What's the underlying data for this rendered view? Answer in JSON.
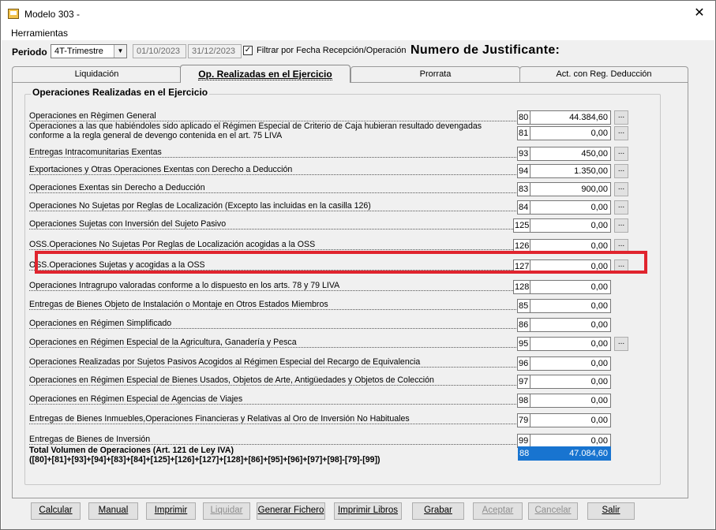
{
  "window": {
    "title": "Modelo 303 -",
    "close_glyph": "✕"
  },
  "menu": {
    "herramientas": "Herramientas"
  },
  "toolbar": {
    "periodo_label": "Periodo",
    "periodo_value": "4T-Trimestre",
    "date_from": "01/10/2023",
    "date_to": "31/12/2023",
    "filter_label": "Filtrar por Fecha Recepción/Operación",
    "filter_checked": "✓",
    "justificante": "Numero de Justificante:"
  },
  "tabs": [
    "Liquidación",
    "Op. Realizadas en el Ejercicio",
    "Prorrata",
    "Act. con Reg. Deducción"
  ],
  "group_title": "Operaciones Realizadas en el Ejercicio",
  "rows": [
    {
      "label": "Operaciones en Règimen General",
      "box": "80",
      "value": "44.384,60",
      "btn": "..."
    },
    {
      "label": "Operaciones a las que habiéndoles sido aplicado el Régimen Especial de Criterio de Caja hubieran resultado devengadas conforme a la regla general de devengo contenida en el art. 75 LIVA",
      "box": "81",
      "value": "0,00",
      "btn": "..."
    },
    {
      "label": "Entregas Intracomunitarias Exentas",
      "box": "93",
      "value": "450,00",
      "btn": "..."
    },
    {
      "label": "Exportaciones y Otras Operaciones Exentas con Derecho a Deducción",
      "box": "94",
      "value": "1.350,00",
      "btn": "..."
    },
    {
      "label": "Operaciones Exentas sin Derecho a Deducción",
      "box": "83",
      "value": "900,00",
      "btn": "..."
    },
    {
      "label": "Operaciones No Sujetas por Reglas de Localización (Excepto las incluidas en la casilla 126)",
      "box": "84",
      "value": "0,00",
      "btn": "..."
    },
    {
      "label": "Operaciones Sujetas con Inversión del Sujeto Pasivo",
      "box": "125",
      "value": "0,00",
      "btn": "..."
    },
    {
      "label": "OSS.Operaciones No Sujetas Por Reglas de Localización acogidas a la OSS",
      "box": "126",
      "value": "0,00",
      "btn": "..."
    },
    {
      "label": "OSS.Operaciones Sujetas y acogidas a la OSS",
      "box": "127",
      "value": "0,00",
      "btn": "..."
    },
    {
      "label": "Operaciones Intragrupo valoradas conforme a lo dispuesto en los arts. 78 y 79 LIVA",
      "box": "128",
      "value": "0,00",
      "btn": ""
    },
    {
      "label": "Entregas de Bienes Objeto de Instalación o Montaje en Otros Estados Miembros",
      "box": "85",
      "value": "0,00",
      "btn": ""
    },
    {
      "label": "Operaciones en Régimen Simplificado",
      "box": "86",
      "value": "0,00",
      "btn": ""
    },
    {
      "label": "Operaciones en Régimen Especial de la Agricultura, Ganadería y Pesca",
      "box": "95",
      "value": "0,00",
      "btn": "..."
    },
    {
      "label": "Operaciones Realizadas por Sujetos Pasivos Acogidos al Régimen Especial del Recargo de Equivalencia",
      "box": "96",
      "value": "0,00",
      "btn": ""
    },
    {
      "label": "Operaciones en Régimen Especial de Bienes Usados, Objetos de Arte, Antigüedades y Objetos de Colección",
      "box": "97",
      "value": "0,00",
      "btn": ""
    },
    {
      "label": "Operaciones en Régimen Especial de Agencias de Viajes",
      "box": "98",
      "value": "0,00",
      "btn": ""
    },
    {
      "label": "Entregas de Bienes Inmuebles,Operaciones Financieras y Relativas al Oro de Inversión No Habituales",
      "box": "79",
      "value": "0,00",
      "btn": ""
    },
    {
      "label": "Entregas de Bienes de Inversión",
      "box": "99",
      "value": "0,00",
      "btn": ""
    }
  ],
  "total": {
    "label_line1": "Total Volumen de Operaciones (Art. 121 de Ley IVA)",
    "label_line2": "([80]+[81]+[93]+[94]+[83]+[84]+[125]+[126]+[127]+[128]+[86]+[95]+[96]+[97]+[98]-[79]-[99])",
    "box": "88",
    "value": "47.084,60"
  },
  "buttons": [
    "Calcular",
    "Manual",
    "Imprimir",
    "Liquidar",
    "Generar Fichero",
    "Imprimir Libros",
    "Grabar",
    "Aceptar",
    "Cancelar",
    "Salir"
  ],
  "colors": {
    "highlight": "#e0242e",
    "total_bg": "#1874d0"
  }
}
